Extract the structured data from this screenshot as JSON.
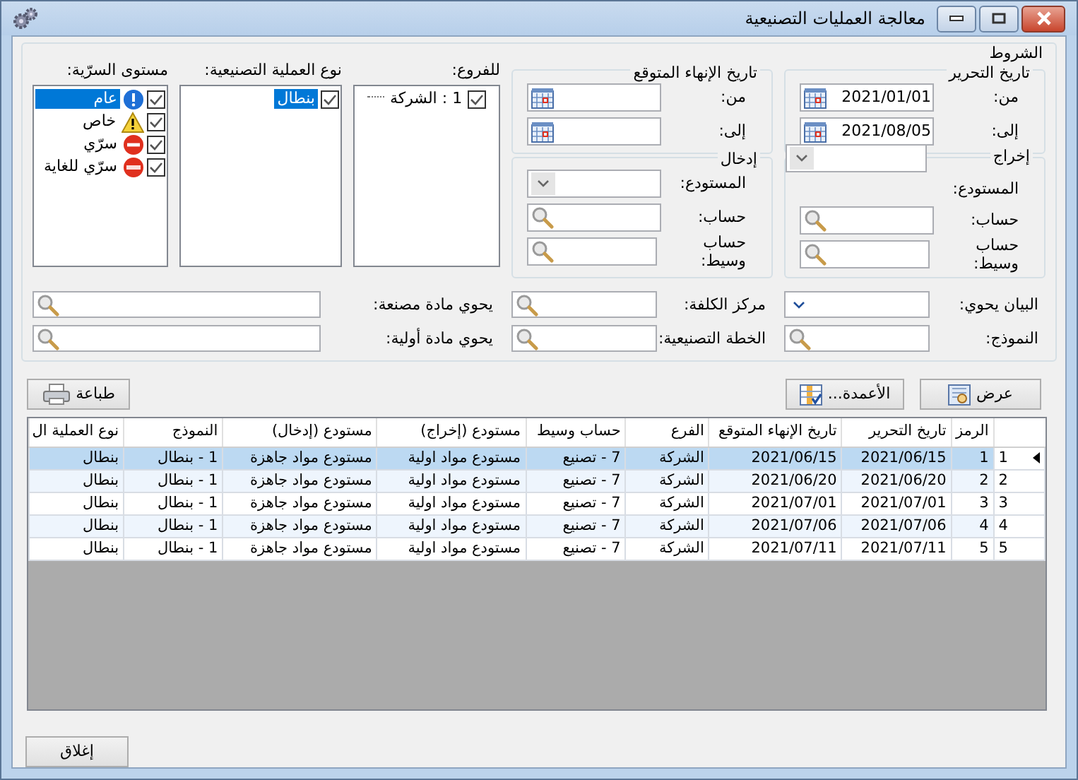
{
  "window": {
    "title": "معالجة العمليات التصنيعية"
  },
  "conditions": {
    "title": "الشروط",
    "edit_date": {
      "title": "تاريخ التحرير",
      "from_label": "من:",
      "from": "2021/01/01",
      "to_label": "إلى:",
      "to": "2021/08/05"
    },
    "expected_end_date": {
      "title": "تاريخ الإنهاء المتوقع",
      "from_label": "من:",
      "to_label": "إلى:"
    },
    "output": {
      "title": "إخراج",
      "warehouse_label": "المستودع:",
      "account_label": "حساب:",
      "intermediate_account_label": "حساب وسيط:"
    },
    "input": {
      "title": "إدخال",
      "warehouse_label": "المستودع:",
      "account_label": "حساب:",
      "intermediate_account_label": "حساب وسيط:"
    },
    "branches": {
      "label": "للفروع:",
      "items": [
        {
          "text": "1 : الشركة",
          "checked": true,
          "selected": false
        }
      ]
    },
    "operation_types": {
      "label": "نوع العملية التصنيعية:",
      "items": [
        {
          "text": "بنطال",
          "checked": true,
          "selected": true
        }
      ]
    },
    "secrecy_levels": {
      "label": "مستوى السرّية:",
      "items": [
        {
          "text": "عام",
          "kind": "info",
          "checked": true,
          "selected": true
        },
        {
          "text": "خاص",
          "kind": "warning",
          "checked": true,
          "selected": false
        },
        {
          "text": "سرّي",
          "kind": "noentry",
          "checked": true,
          "selected": false
        },
        {
          "text": "سرّي للغاية",
          "kind": "stop",
          "checked": true,
          "selected": false
        }
      ]
    },
    "fields": [
      {
        "label": "البيان يحوي:",
        "kind": "dropdown"
      },
      {
        "label": "مركز الكلفة:",
        "kind": "search"
      },
      {
        "label": "يحوي مادة مصنعة:",
        "kind": "search"
      },
      {
        "label": "النموذج:",
        "kind": "search"
      },
      {
        "label": "الخطة التصنيعية:",
        "kind": "search"
      },
      {
        "label": "يحوي مادة أولية:",
        "kind": "search"
      }
    ]
  },
  "toolbar_buttons": [
    {
      "kind": "view",
      "label": "عرض"
    },
    {
      "kind": "columns",
      "label": "الأعمدة..."
    },
    {
      "kind": "print",
      "label": "طباعة"
    }
  ],
  "table": {
    "columns": [
      "الرمز",
      "تاريخ التحرير",
      "تاريخ الإنهاء المتوقع",
      "الفرع",
      "حساب وسيط",
      "مستودع (إخراج)",
      "مستودع (إدخال)",
      "النموذج",
      "نوع العملية ال"
    ],
    "rows": [
      {
        "number": "1",
        "current": true,
        "selected": true,
        "cells": [
          "1",
          "2021/06/15",
          "2021/06/15",
          "الشركة",
          "7 - تصنيع",
          "مستودع مواد اولية",
          "مستودع مواد جاهزة",
          "1 - بنطال",
          "بنطال"
        ]
      },
      {
        "number": "2",
        "current": false,
        "selected": false,
        "cells": [
          "2",
          "2021/06/20",
          "2021/06/20",
          "الشركة",
          "7 - تصنيع",
          "مستودع مواد اولية",
          "مستودع مواد جاهزة",
          "1 - بنطال",
          "بنطال"
        ]
      },
      {
        "number": "3",
        "current": false,
        "selected": false,
        "cells": [
          "3",
          "2021/07/01",
          "2021/07/01",
          "الشركة",
          "7 - تصنيع",
          "مستودع مواد اولية",
          "مستودع مواد جاهزة",
          "1 - بنطال",
          "بنطال"
        ]
      },
      {
        "number": "4",
        "current": false,
        "selected": false,
        "cells": [
          "4",
          "2021/07/06",
          "2021/07/06",
          "الشركة",
          "7 - تصنيع",
          "مستودع مواد اولية",
          "مستودع مواد جاهزة",
          "1 - بنطال",
          "بنطال"
        ]
      },
      {
        "number": "5",
        "current": false,
        "selected": false,
        "cells": [
          "5",
          "2021/07/11",
          "2021/07/11",
          "الشركة",
          "7 - تصنيع",
          "مستودع مواد اولية",
          "مستودع مواد جاهزة",
          "1 - بنطال",
          "بنطال"
        ]
      }
    ]
  },
  "close_button": {
    "label": "إغلاق"
  }
}
